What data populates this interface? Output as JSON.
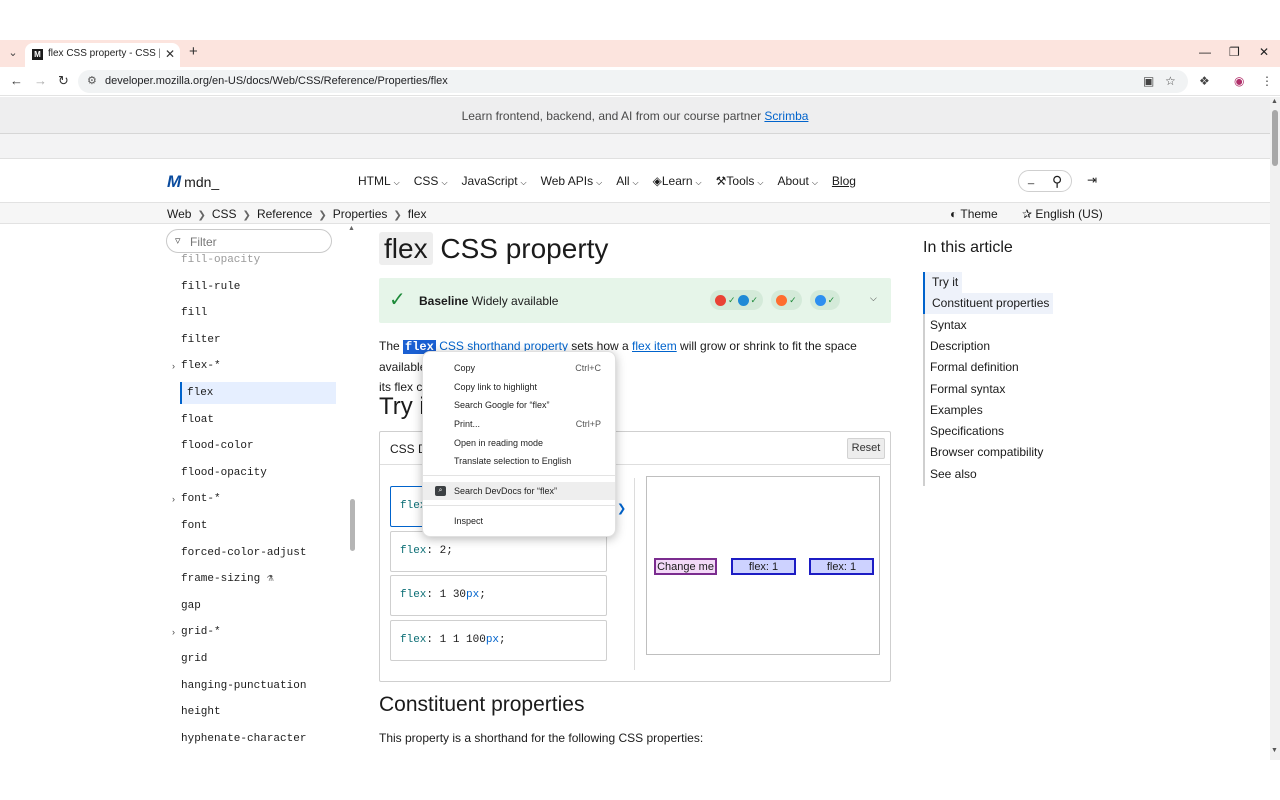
{
  "browser": {
    "tab_title": "flex CSS property - CSS | MDN",
    "url": "developer.mozilla.org/en-US/docs/Web/CSS/Reference/Properties/flex"
  },
  "banner": {
    "text": "Learn frontend, backend, and AI from our course partner",
    "link": "Scrimba"
  },
  "header": {
    "logo": "mdn_",
    "nav": [
      "HTML",
      "CSS",
      "JavaScript",
      "Web APIs",
      "All",
      "Learn",
      "Tools",
      "About"
    ],
    "blog": "Blog",
    "search_value": "_"
  },
  "breadcrumb": [
    "Web",
    "CSS",
    "Reference",
    "Properties",
    "flex"
  ],
  "theme_label": "Theme",
  "language_label": "English (US)",
  "sidebar": {
    "filter_placeholder": "Filter",
    "items": [
      {
        "label": "fill-opacity",
        "faded": true
      },
      {
        "label": "fill-rule"
      },
      {
        "label": "fill"
      },
      {
        "label": "filter"
      },
      {
        "label": "flex-*",
        "expandable": true
      },
      {
        "label": "flex",
        "active": true
      },
      {
        "label": "float"
      },
      {
        "label": "flood-color"
      },
      {
        "label": "flood-opacity"
      },
      {
        "label": "font-*",
        "expandable": true
      },
      {
        "label": "font"
      },
      {
        "label": "forced-color-adjust"
      },
      {
        "label": "frame-sizing",
        "experimental": true
      },
      {
        "label": "gap"
      },
      {
        "label": "grid-*",
        "expandable": true
      },
      {
        "label": "grid"
      },
      {
        "label": "hanging-punctuation"
      },
      {
        "label": "height"
      },
      {
        "label": "hyphenate-character"
      }
    ]
  },
  "article": {
    "title_code": "flex",
    "title_rest": "CSS property",
    "baseline_bold": "Baseline",
    "baseline_text": "Widely available",
    "para_the": "The",
    "para_selected": "flex",
    "para_css": "CSS",
    "para_shorthand": "shorthand property",
    "para_mid": "sets how a",
    "para_flexitem": "flex item",
    "para_end": "will grow or shrink to fit the space available in",
    "para_line2": "its flex co",
    "try_heading": "Try it",
    "demo_title": "CSS D",
    "reset_label": "Reset",
    "choices": [
      {
        "prop": "flex",
        "value": ""
      },
      {
        "prop": "flex",
        "value": " 2;"
      },
      {
        "prop": "flex",
        "value": " 1 30",
        "unit": "px",
        "tail": ";"
      },
      {
        "prop": "flex",
        "value": " 1 1 100",
        "unit": "px",
        "tail": ";"
      }
    ],
    "output_boxes": [
      "Change me",
      "flex: 1",
      "flex: 1"
    ],
    "constituent_heading": "Constituent properties",
    "constituent_text": "This property is a shorthand for the following CSS properties:"
  },
  "toc": {
    "title": "In this article",
    "items": [
      "Try it",
      "Constituent properties",
      "Syntax",
      "Description",
      "Formal definition",
      "Formal syntax",
      "Examples",
      "Specifications",
      "Browser compatibility",
      "See also"
    ]
  },
  "context_menu": {
    "items": [
      {
        "label": "Copy",
        "shortcut": "Ctrl+C"
      },
      {
        "label": "Copy link to highlight"
      },
      {
        "label": "Search Google for “flex”"
      },
      {
        "label": "Print...",
        "shortcut": "Ctrl+P"
      },
      {
        "label": "Open in reading mode"
      },
      {
        "label": "Translate selection to English"
      },
      {
        "label": "Search DevDocs for “flex”"
      },
      {
        "label": "Inspect"
      }
    ]
  },
  "colors": {
    "tab_strip": "#fce4de",
    "link": "#0063cc",
    "baseline_bg": "#e6f5e9",
    "selection": "#1a5fd2"
  }
}
